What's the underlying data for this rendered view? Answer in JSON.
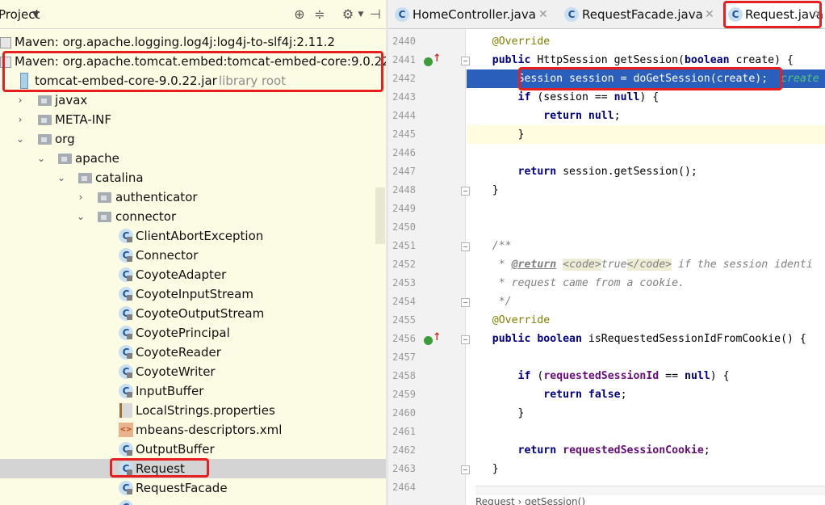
{
  "project_panel": {
    "title": "Project",
    "dropdown_icon": "caret-down-icon",
    "toolbar_icons": [
      "locate-icon",
      "collapse-all-icon",
      "settings-gear-icon",
      "hide-panel-icon"
    ]
  },
  "tree": {
    "rows": [
      {
        "label": "Maven: org.apache.logging.log4j:log4j-to-slf4j:2.11.2",
        "icon": "maven-library-icon"
      },
      {
        "label": "Maven: org.apache.tomcat.embed:tomcat-embed-core:9.0.22",
        "icon": "maven-library-icon"
      },
      {
        "label": "tomcat-embed-core-9.0.22.jar",
        "hint": "library root",
        "icon": "jar-icon"
      },
      {
        "label": "javax",
        "icon": "package-icon"
      },
      {
        "label": "META-INF",
        "icon": "folder-icon"
      },
      {
        "label": "org",
        "icon": "package-icon"
      },
      {
        "label": "apache",
        "icon": "package-icon"
      },
      {
        "label": "catalina",
        "icon": "package-icon"
      },
      {
        "label": "authenticator",
        "icon": "package-icon"
      },
      {
        "label": "connector",
        "icon": "package-icon"
      },
      {
        "label": "ClientAbortException",
        "icon": "class-icon"
      },
      {
        "label": "Connector",
        "icon": "class-icon"
      },
      {
        "label": "CoyoteAdapter",
        "icon": "class-icon"
      },
      {
        "label": "CoyoteInputStream",
        "icon": "class-icon"
      },
      {
        "label": "CoyoteOutputStream",
        "icon": "class-icon"
      },
      {
        "label": "CoyotePrincipal",
        "icon": "class-icon"
      },
      {
        "label": "CoyoteReader",
        "icon": "class-icon"
      },
      {
        "label": "CoyoteWriter",
        "icon": "class-icon"
      },
      {
        "label": "InputBuffer",
        "icon": "class-icon"
      },
      {
        "label": "LocalStrings.properties",
        "icon": "properties-file-icon"
      },
      {
        "label": "mbeans-descriptors.xml",
        "icon": "xml-file-icon"
      },
      {
        "label": "OutputBuffer",
        "icon": "class-icon"
      },
      {
        "label": "Request",
        "icon": "class-icon",
        "selected": true
      },
      {
        "label": "RequestFacade",
        "icon": "class-icon"
      }
    ]
  },
  "tabs": [
    {
      "label": "HomeController.java",
      "icon": "class-icon"
    },
    {
      "label": "RequestFacade.java",
      "icon": "class-icon"
    },
    {
      "label": "Request.java",
      "icon": "class-icon",
      "active": true
    }
  ],
  "editor": {
    "line_numbers": [
      "2440",
      "2441",
      "2442",
      "2443",
      "2444",
      "2445",
      "2446",
      "2447",
      "2448",
      "2449",
      "2450",
      "2451",
      "2452",
      "2453",
      "2454",
      "2455",
      "2456",
      "2457",
      "2458",
      "2459",
      "2460",
      "2461",
      "2462",
      "2463",
      "2464"
    ],
    "code": {
      "l2440_ann": "@Override",
      "l2441_kw1": "public",
      "l2441_rest1": " HttpSession getSession(",
      "l2441_kw2": "boolean",
      "l2441_rest2": " create) {",
      "l2442_code": "Session session = doGetSession(create);",
      "l2442_hint": "create",
      "l2443_kw1": "if",
      "l2443_rest1": " (session == ",
      "l2443_kw2": "null",
      "l2443_rest2": ") {",
      "l2444_kw1": "return",
      "l2444_kw2": "null",
      "l2444_rest": ";",
      "l2445_code": "}",
      "l2447_kw": "return",
      "l2447_rest": " session.getSession();",
      "l2448_code": "}",
      "l2451_cm": "/**",
      "l2452_cm1": " * ",
      "l2452_tag1": "@return",
      "l2452_code_open": "<code>",
      "l2452_true": "true",
      "l2452_code_close": "</code>",
      "l2452_cm2": " if the session identi",
      "l2453_cm": " * request came from a cookie.",
      "l2454_cm": " */",
      "l2455_ann": "@Override",
      "l2456_kw1": "public",
      "l2456_kw2": "boolean",
      "l2456_rest": " isRequestedSessionIdFromCookie() {",
      "l2458_kw1": "if",
      "l2458_fld": "requestedSessionId",
      "l2458_rest1": " (",
      "l2458_rest2": " == ",
      "l2458_kw2": "null",
      "l2458_rest3": ") {",
      "l2459_kw1": "return",
      "l2459_kw2": "false",
      "l2459_rest": ";",
      "l2460_code": "}",
      "l2462_kw": "return",
      "l2462_fld": "requestedSessionCookie",
      "l2462_rest": ";",
      "l2463_code": "}"
    },
    "footer_breadcrumb": "Request › getSession()"
  },
  "colors": {
    "project_bg": "#fcfbe4",
    "selection_line": "#2a5fbb",
    "annotation_box": "#e62020",
    "keyword": "#000080",
    "comment": "#808080"
  }
}
